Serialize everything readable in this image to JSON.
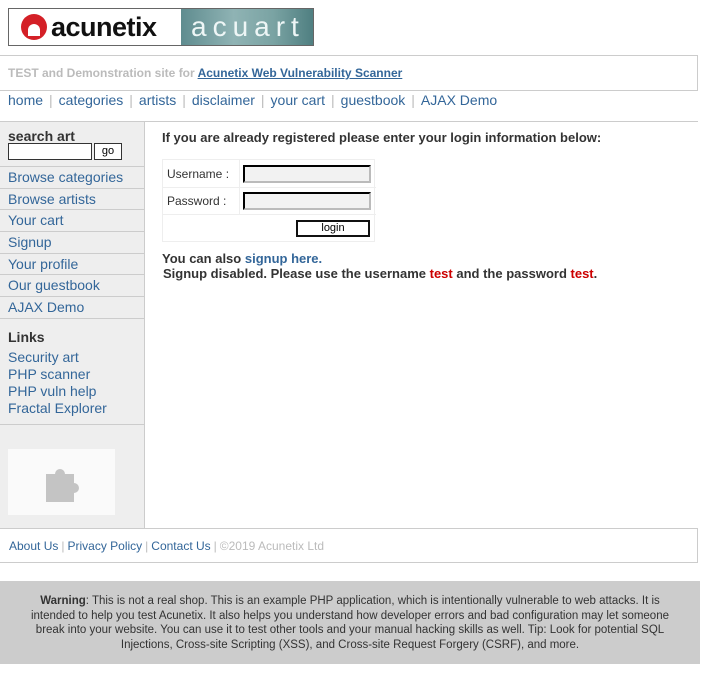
{
  "logo": {
    "left_text": "acunetix",
    "right_text": "acuart"
  },
  "tagline": {
    "prefix": "TEST and Demonstration site for",
    "link": "Acunetix Web Vulnerability Scanner"
  },
  "topnav": {
    "items": [
      "home",
      "categories",
      "artists",
      "disclaimer",
      "your cart",
      "guestbook",
      "AJAX Demo"
    ]
  },
  "sidebar": {
    "search_title": "search art",
    "search_value": "",
    "go_label": "go",
    "menu": [
      "Browse categories",
      "Browse artists",
      "Your cart",
      "Signup",
      "Your profile",
      "Our guestbook",
      "AJAX Demo"
    ],
    "links_title": "Links",
    "links": [
      "Security art",
      "PHP scanner",
      "PHP vuln help",
      "Fractal Explorer"
    ]
  },
  "main": {
    "heading": "If you are already registered please enter your login information below:",
    "username_label": "Username :",
    "password_label": "Password :",
    "username_value": "",
    "password_value": "",
    "login_label": "login",
    "also_prefix": "You can also",
    "signup_link": "signup here.",
    "disabled_1": "Signup disabled. Please use the username",
    "test_user": "test",
    "disabled_2": "and the password",
    "test_pass": "test",
    "disabled_end": "."
  },
  "footer": {
    "about": "About Us",
    "privacy": "Privacy Policy",
    "contact": "Contact Us",
    "copyright": "©2019 Acunetix Ltd",
    "sep": "|"
  },
  "warning": {
    "label": "Warning",
    "text": ": This is not a real shop. This is an example PHP application, which is intentionally vulnerable to web attacks. It is intended to help you test Acunetix. It also helps you understand how developer errors and bad configuration may let someone break into your website. You can use it to test other tools and your manual hacking skills as well. Tip: Look for potential SQL Injections, Cross-site Scripting (XSS), and Cross-site Request Forgery (CSRF), and more."
  },
  "colors": {
    "link": "#336699",
    "highlight": "#cc0000",
    "sidebar_bg": "#eeeeee",
    "warning_bg": "#cccccc"
  },
  "icons": {
    "plugin": "puzzle-piece-icon"
  }
}
